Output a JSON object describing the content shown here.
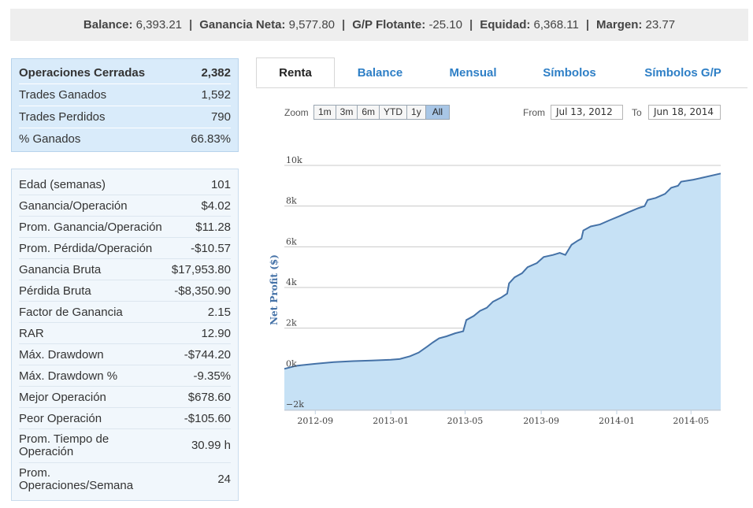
{
  "summary": {
    "balance_label": "Balance:",
    "balance_value": "6,393.21",
    "net_gain_label": "Ganancia Neta:",
    "net_gain_value": "9,577.80",
    "floating_label": "G/P Flotante:",
    "floating_value": "-25.10",
    "equity_label": "Equidad:",
    "equity_value": "6,368.11",
    "margin_label": "Margen:",
    "margin_value": "23.77",
    "separator": "|"
  },
  "closed": [
    {
      "label": "Operaciones Cerradas",
      "value": "2,382"
    },
    {
      "label": "Trades Ganados",
      "value": "1,592"
    },
    {
      "label": "Trades Perdidos",
      "value": "790"
    },
    {
      "label": "% Ganados",
      "value": "66.83%"
    }
  ],
  "stats": [
    {
      "label": "Edad (semanas)",
      "value": "101"
    },
    {
      "label": "Ganancia/Operación",
      "value": "$4.02"
    },
    {
      "label": "Prom. Ganancia/Operación",
      "value": "$11.28"
    },
    {
      "label": "Prom. Pérdida/Operación",
      "value": "-$10.57"
    },
    {
      "label": "Ganancia Bruta",
      "value": "$17,953.80"
    },
    {
      "label": "Pérdida Bruta",
      "value": "-$8,350.90"
    },
    {
      "label": "Factor de Ganancia",
      "value": "2.15"
    },
    {
      "label": "RAR",
      "value": "12.90"
    },
    {
      "label": "Máx. Drawdown",
      "value": "-$744.20"
    },
    {
      "label": "Máx. Drawdown %",
      "value": "-9.35%"
    },
    {
      "label": "Mejor Operación",
      "value": "$678.60"
    },
    {
      "label": "Peor Operación",
      "value": "-$105.60"
    },
    {
      "label": "Prom. Tiempo de Operación",
      "value": "30.99 h"
    },
    {
      "label": "Prom. Operaciones/Semana",
      "value": "24"
    }
  ],
  "tabs": [
    {
      "label": "Renta",
      "active": true
    },
    {
      "label": "Balance",
      "active": false
    },
    {
      "label": "Mensual",
      "active": false
    },
    {
      "label": "Símbolos",
      "active": false
    },
    {
      "label": "Símbolos G/P",
      "active": false
    }
  ],
  "zoom": {
    "label": "Zoom",
    "buttons": [
      "1m",
      "3m",
      "6m",
      "YTD",
      "1y",
      "All"
    ],
    "active": "All",
    "from_label": "From",
    "from_value": "Jul 13, 2012",
    "to_label": "To",
    "to_value": "Jun 18, 2014"
  },
  "colors": {
    "accent": "#2e7fc6",
    "line": "#4572a7",
    "area": "#c6e1f5"
  },
  "chart_data": {
    "type": "area",
    "ylabel": "Net Profit ($)",
    "ylim": [
      -2000,
      10000
    ],
    "yticks": [
      -2000,
      0,
      2000,
      4000,
      6000,
      8000,
      10000
    ],
    "ytick_labels": [
      "−2k",
      "0k",
      "2k",
      "4k",
      "6k",
      "8k",
      "10k"
    ],
    "xlim": [
      "2012-07-13",
      "2014-06-18"
    ],
    "xticks": [
      "2012-09-01",
      "2013-01-01",
      "2013-05-01",
      "2013-09-01",
      "2014-01-01",
      "2014-05-01"
    ],
    "xtick_labels": [
      "2012-09",
      "2013-01",
      "2013-05",
      "2013-09",
      "2014-01",
      "2014-05"
    ],
    "grid": true,
    "series": [
      {
        "points": [
          [
            "2012-07-13",
            0
          ],
          [
            "2012-08-01",
            150
          ],
          [
            "2012-09-01",
            250
          ],
          [
            "2012-10-01",
            330
          ],
          [
            "2012-11-01",
            380
          ],
          [
            "2012-12-01",
            410
          ],
          [
            "2013-01-01",
            450
          ],
          [
            "2013-01-15",
            480
          ],
          [
            "2013-02-01",
            620
          ],
          [
            "2013-02-15",
            800
          ],
          [
            "2013-03-01",
            1100
          ],
          [
            "2013-03-10",
            1300
          ],
          [
            "2013-03-20",
            1500
          ],
          [
            "2013-04-01",
            1600
          ],
          [
            "2013-04-15",
            1750
          ],
          [
            "2013-04-28",
            1850
          ],
          [
            "2013-05-03",
            2400
          ],
          [
            "2013-05-15",
            2600
          ],
          [
            "2013-05-25",
            2850
          ],
          [
            "2013-06-05",
            3000
          ],
          [
            "2013-06-15",
            3300
          ],
          [
            "2013-06-28",
            3500
          ],
          [
            "2013-07-08",
            3700
          ],
          [
            "2013-07-11",
            4200
          ],
          [
            "2013-07-20",
            4500
          ],
          [
            "2013-08-01",
            4700
          ],
          [
            "2013-08-10",
            5000
          ],
          [
            "2013-08-25",
            5200
          ],
          [
            "2013-09-05",
            5500
          ],
          [
            "2013-09-20",
            5600
          ],
          [
            "2013-10-01",
            5700
          ],
          [
            "2013-10-10",
            5600
          ],
          [
            "2013-10-20",
            6100
          ],
          [
            "2013-10-30",
            6300
          ],
          [
            "2013-11-05",
            6400
          ],
          [
            "2013-11-08",
            6800
          ],
          [
            "2013-11-20",
            7000
          ],
          [
            "2013-12-05",
            7100
          ],
          [
            "2013-12-20",
            7300
          ],
          [
            "2014-01-05",
            7500
          ],
          [
            "2014-01-20",
            7700
          ],
          [
            "2014-02-05",
            7900
          ],
          [
            "2014-02-15",
            8000
          ],
          [
            "2014-02-20",
            8300
          ],
          [
            "2014-03-05",
            8400
          ],
          [
            "2014-03-20",
            8600
          ],
          [
            "2014-03-30",
            8900
          ],
          [
            "2014-04-10",
            9000
          ],
          [
            "2014-04-15",
            9200
          ],
          [
            "2014-05-05",
            9300
          ],
          [
            "2014-05-20",
            9400
          ],
          [
            "2014-06-18",
            9600
          ]
        ]
      }
    ]
  }
}
